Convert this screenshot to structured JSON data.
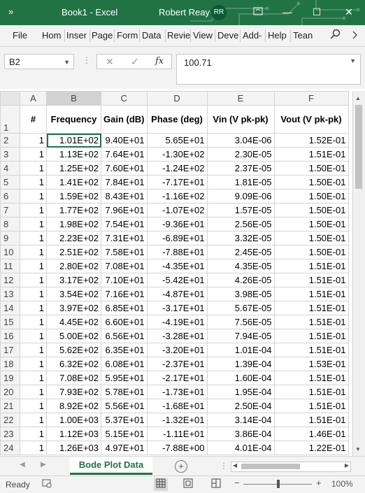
{
  "titlebar": {
    "qat": "»",
    "document_title": "Book1  -  Excel",
    "user_name": "Robert Reay",
    "user_initials": "RR",
    "minimize": "—",
    "maximize": "☐",
    "close": "✕",
    "accent_color": "#217346"
  },
  "ribbon": {
    "tabs": [
      "File",
      "Hom",
      "Inser",
      "Page",
      "Form",
      "Data",
      "Revie",
      "View",
      "Deve",
      "Add-",
      "Help",
      "Tean"
    ],
    "search_icon": "search-icon",
    "more_icon": "chevron-right-icon"
  },
  "formula_bar": {
    "name_box": "B2",
    "cancel_icon": "✕",
    "enter_icon": "✓",
    "fx_icon": "fx",
    "value": "100.71"
  },
  "sheet": {
    "columns": [
      "A",
      "B",
      "C",
      "D",
      "E",
      "F"
    ],
    "header_row": {
      "row_number": "1",
      "cells": [
        "#",
        "Frequency",
        "Gain (dB)",
        "Phase (deg)",
        "Vin (V pk-pk)",
        "Vout  (V pk-pk)"
      ]
    },
    "rows": [
      {
        "n": "2",
        "cells": [
          "1",
          "1.01E+02",
          "9.40E+01",
          "5.65E+01",
          "3.04E-06",
          "1.52E-01"
        ]
      },
      {
        "n": "3",
        "cells": [
          "1",
          "1.13E+02",
          "7.64E+01",
          "-1.30E+02",
          "2.30E-05",
          "1.51E-01"
        ]
      },
      {
        "n": "4",
        "cells": [
          "1",
          "1.25E+02",
          "7.60E+01",
          "-1.24E+02",
          "2.37E-05",
          "1.50E-01"
        ]
      },
      {
        "n": "5",
        "cells": [
          "1",
          "1.41E+02",
          "7.84E+01",
          "-7.17E+01",
          "1.81E-05",
          "1.50E-01"
        ]
      },
      {
        "n": "6",
        "cells": [
          "1",
          "1.59E+02",
          "8.43E+01",
          "-1.16E+02",
          "9.09E-06",
          "1.50E-01"
        ]
      },
      {
        "n": "7",
        "cells": [
          "1",
          "1.77E+02",
          "7.96E+01",
          "-1.07E+02",
          "1.57E-05",
          "1.50E-01"
        ]
      },
      {
        "n": "8",
        "cells": [
          "1",
          "1.98E+02",
          "7.54E+01",
          "-9.36E+01",
          "2.56E-05",
          "1.50E-01"
        ]
      },
      {
        "n": "9",
        "cells": [
          "1",
          "2.23E+02",
          "7.31E+01",
          "-6.89E+01",
          "3.32E-05",
          "1.50E-01"
        ]
      },
      {
        "n": "10",
        "cells": [
          "1",
          "2.51E+02",
          "7.58E+01",
          "-7.88E+01",
          "2.45E-05",
          "1.50E-01"
        ]
      },
      {
        "n": "11",
        "cells": [
          "1",
          "2.80E+02",
          "7.08E+01",
          "-4.35E+01",
          "4.35E-05",
          "1.51E-01"
        ]
      },
      {
        "n": "12",
        "cells": [
          "1",
          "3.17E+02",
          "7.10E+01",
          "-5.42E+01",
          "4.26E-05",
          "1.51E-01"
        ]
      },
      {
        "n": "13",
        "cells": [
          "1",
          "3.54E+02",
          "7.16E+01",
          "-4.87E+01",
          "3.98E-05",
          "1.51E-01"
        ]
      },
      {
        "n": "14",
        "cells": [
          "1",
          "3.97E+02",
          "6.85E+01",
          "-3.17E+01",
          "5.67E-05",
          "1.51E-01"
        ]
      },
      {
        "n": "15",
        "cells": [
          "1",
          "4.45E+02",
          "6.60E+01",
          "-4.19E+01",
          "7.56E-05",
          "1.51E-01"
        ]
      },
      {
        "n": "16",
        "cells": [
          "1",
          "5.00E+02",
          "6.56E+01",
          "-3.28E+01",
          "7.94E-05",
          "1.51E-01"
        ]
      },
      {
        "n": "17",
        "cells": [
          "1",
          "5.62E+02",
          "6.35E+01",
          "-3.20E+01",
          "1.01E-04",
          "1.51E-01"
        ]
      },
      {
        "n": "18",
        "cells": [
          "1",
          "6.32E+02",
          "6.08E+01",
          "-2.37E+01",
          "1.39E-04",
          "1.53E-01"
        ]
      },
      {
        "n": "19",
        "cells": [
          "1",
          "7.08E+02",
          "5.95E+01",
          "-2.17E+01",
          "1.60E-04",
          "1.51E-01"
        ]
      },
      {
        "n": "20",
        "cells": [
          "1",
          "7.93E+02",
          "5.78E+01",
          "-1.73E+01",
          "1.95E-04",
          "1.51E-01"
        ]
      },
      {
        "n": "21",
        "cells": [
          "1",
          "8.92E+02",
          "5.56E+01",
          "-1.68E+01",
          "2.50E-04",
          "1.51E-01"
        ]
      },
      {
        "n": "22",
        "cells": [
          "1",
          "1.00E+03",
          "5.37E+01",
          "-1.32E+01",
          "3.14E-04",
          "1.51E-01"
        ]
      },
      {
        "n": "23",
        "cells": [
          "1",
          "1.12E+03",
          "5.15E+01",
          "-1.11E+01",
          "3.86E-04",
          "1.46E-01"
        ]
      },
      {
        "n": "24",
        "cells": [
          "1",
          "1.26E+03",
          "4.97E+01",
          "-7.88E+00",
          "4.01E-04",
          "1.22E-01"
        ]
      }
    ]
  },
  "sheet_tabs": {
    "active": "Bode Plot Data",
    "add": "+"
  },
  "status": {
    "ready": "Ready",
    "zoom": "100%",
    "zoom_minus": "−",
    "zoom_plus": "+",
    "zoom_level": 1.0
  }
}
